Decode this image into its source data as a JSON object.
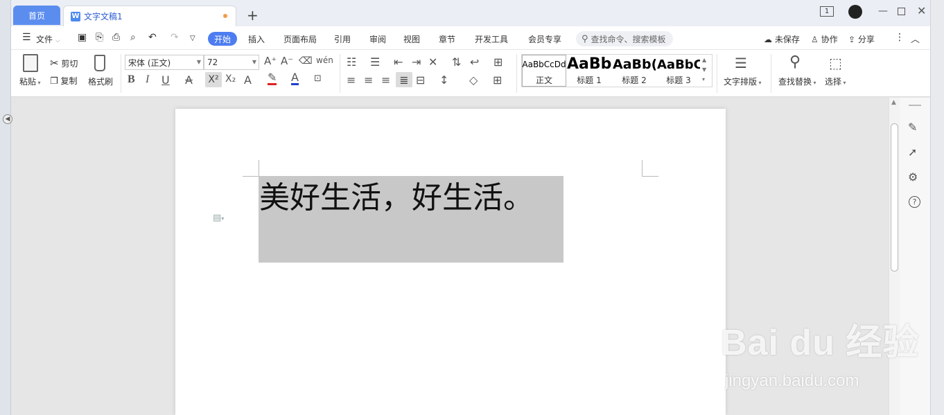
{
  "tabs": {
    "home": "首页",
    "doc": "文字文稿1"
  },
  "window": {
    "pages_badge": "1"
  },
  "menu": {
    "file": "文件",
    "items": [
      "开始",
      "插入",
      "页面布局",
      "引用",
      "审阅",
      "视图",
      "章节",
      "开发工具",
      "会员专享"
    ],
    "search_placeholder": "查找命令、搜索模板",
    "unsaved": "未保存",
    "collaborate": "协作",
    "share": "分享"
  },
  "toolbar": {
    "paste": "粘贴",
    "cut": "剪切",
    "copy": "复制",
    "format_painter": "格式刷",
    "font_name": "宋体 (正文)",
    "font_size": "72",
    "styles": [
      {
        "preview": "AaBbCcDd",
        "label": "正文"
      },
      {
        "preview": "AaBb",
        "label": "标题 1"
      },
      {
        "preview": "AaBb(",
        "label": "标题 2"
      },
      {
        "preview": "AaBbC",
        "label": "标题 3"
      }
    ],
    "text_layout": "文字排版",
    "find_replace": "查找替换",
    "select": "选择"
  },
  "document": {
    "text": "美好生活，好生活。"
  },
  "watermark": {
    "brand": "Bai du 经验",
    "url": "jingyan.baidu.com"
  },
  "colors": {
    "accent": "#4d7df0",
    "selection": "#c8c8c8",
    "font_color_red": "#e02020",
    "font_color_blue": "#1f3fd0"
  }
}
